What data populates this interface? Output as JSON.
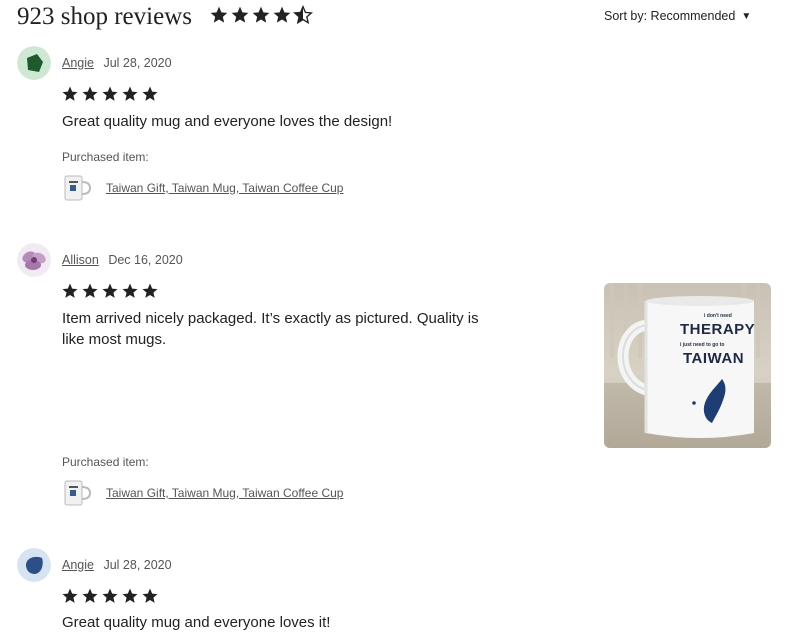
{
  "header": {
    "title": "923 shop reviews",
    "rating_stars": 4.5,
    "sort_label": "Sort by: Recommended",
    "sort_caret": "▼"
  },
  "reviews": [
    {
      "name": "Angie",
      "date": "Jul 28, 2020",
      "stars": 5,
      "text": "Great quality mug and everyone loves the design!",
      "purchased_label": "Purchased item:",
      "item_link": "Taiwan Gift, Taiwan Mug, Taiwan Coffee Cup"
    },
    {
      "name": "Allison",
      "date": "Dec 16, 2020",
      "stars": 5,
      "text_line1": "Item arrived nicely packaged. It’s exactly as pictured. Quality is",
      "text_line2": "like most mugs.",
      "purchased_label": "Purchased item:",
      "item_link": "Taiwan Gift, Taiwan Mug, Taiwan Coffee Cup",
      "photo": {
        "line1": "i don't need",
        "line2": "THERAPY",
        "line3": "i just need to go to",
        "line4": "TAIWAN"
      }
    },
    {
      "name": "Angie",
      "date": "Jul 28, 2020",
      "stars": 5,
      "text": "Great quality mug and everyone loves it!"
    }
  ],
  "colors": {
    "star": "#222222",
    "avatar1_bg": "#cfe8d4",
    "avatar1_shape": "#1f5a2d",
    "avatar3_bg": "#d6e4f2",
    "avatar3_shape": "#2c4f86",
    "mug_print": "#1e3d73"
  }
}
